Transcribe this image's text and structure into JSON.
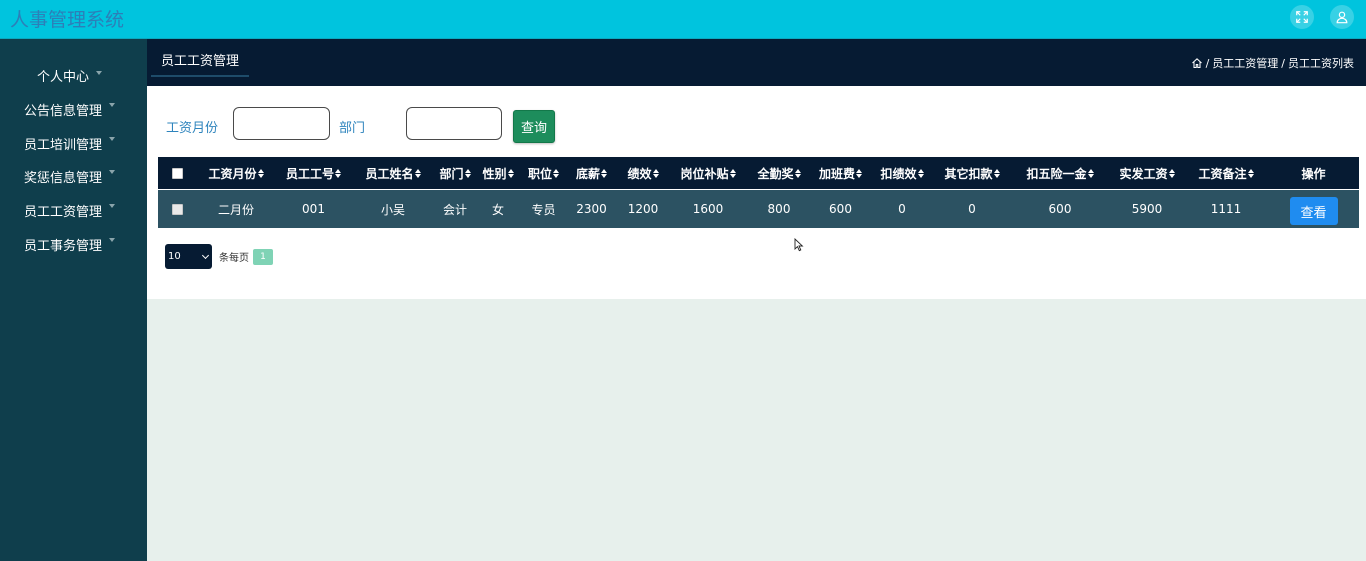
{
  "app": {
    "title": "人事管理系统"
  },
  "topbar_icons": [
    "fullscreen-icon",
    "user-icon"
  ],
  "sidebar": {
    "items": [
      {
        "label": "个人中心"
      },
      {
        "label": "公告信息管理"
      },
      {
        "label": "员工培训管理"
      },
      {
        "label": "奖惩信息管理"
      },
      {
        "label": "员工工资管理"
      },
      {
        "label": "员工事务管理"
      }
    ]
  },
  "tabs": {
    "active": "员工工资管理"
  },
  "breadcrumb": {
    "items": [
      "员工工资管理",
      "员工工资列表"
    ],
    "sep": "/"
  },
  "search": {
    "month_label": "工资月份",
    "month_value": "",
    "dept_label": "部门",
    "dept_value": "",
    "query_button": "查询"
  },
  "table": {
    "columns": [
      "工资月份",
      "员工工号",
      "员工姓名",
      "部门",
      "性别",
      "职位",
      "底薪",
      "绩效",
      "岗位补贴",
      "全勤奖",
      "加班费",
      "扣绩效",
      "其它扣款",
      "扣五险一金",
      "实发工资",
      "工资备注",
      "操作"
    ],
    "rows": [
      {
        "cells": [
          "二月份",
          "001",
          "小吴",
          "会计",
          "女",
          "专员",
          "2300",
          "1200",
          "1600",
          "800",
          "600",
          "0",
          "0",
          "600",
          "5900",
          "1111"
        ],
        "action": "查看"
      }
    ]
  },
  "pagination": {
    "page_size": "10",
    "per_page_label": "条每页",
    "current_page": "1"
  },
  "colors": {
    "topbar": "#00c4de",
    "sidebar": "#0f3e4c",
    "header_dark": "#061b33",
    "row": "#2c5262",
    "query_button": "#1d8d5c",
    "view_button": "#1f8cf0",
    "page_active": "#7fd3b5",
    "content_bg": "#e7f0ec"
  }
}
